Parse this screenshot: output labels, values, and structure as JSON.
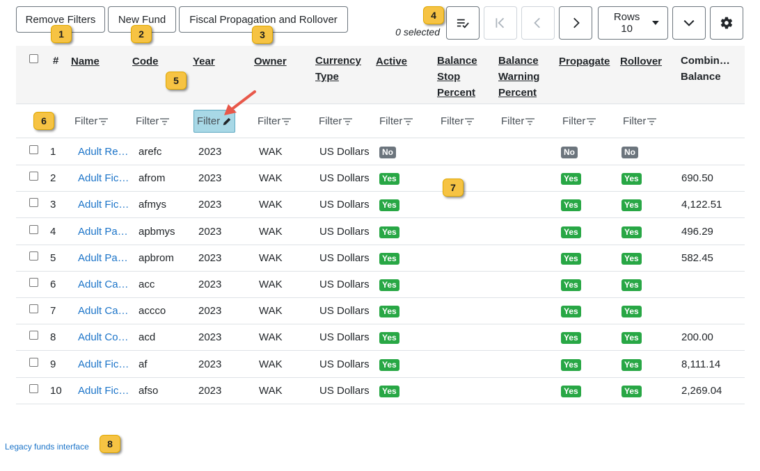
{
  "toolbar": {
    "remove_filters": "Remove Filters",
    "new_fund": "New Fund",
    "fiscal": "Fiscal Propagation and Rollover",
    "selected": "0 selected",
    "rows_label": "Rows 10"
  },
  "markers": [
    "1",
    "2",
    "3",
    "4",
    "5",
    "6",
    "7",
    "8"
  ],
  "columns": {
    "hash": "#",
    "name": "Name",
    "code": "Code",
    "year": "Year",
    "owner": "Owner",
    "currency_l1": "Currency",
    "currency_l2": "Type",
    "active": "Active",
    "stop_l1": "Balance",
    "stop_l2": "Stop",
    "stop_l3": "Percent",
    "warn_l1": "Balance",
    "warn_l2": "Warning",
    "warn_l3": "Percent",
    "propagate": "Propagate",
    "rollover": "Rollover",
    "combined_l1": "Combin…",
    "combined_l2": "Balance"
  },
  "filter_label": "Filter",
  "rows": [
    {
      "num": "1",
      "name": "Adult Re…",
      "code": "arefc",
      "year": "2023",
      "owner": "WAK",
      "currency": "US Dollars",
      "active": "No",
      "propagate": "No",
      "rollover": "No",
      "balance": ""
    },
    {
      "num": "2",
      "name": "Adult Fic…",
      "code": "afrom",
      "year": "2023",
      "owner": "WAK",
      "currency": "US Dollars",
      "active": "Yes",
      "propagate": "Yes",
      "rollover": "Yes",
      "balance": "690.50"
    },
    {
      "num": "3",
      "name": "Adult Fic…",
      "code": "afmys",
      "year": "2023",
      "owner": "WAK",
      "currency": "US Dollars",
      "active": "Yes",
      "propagate": "Yes",
      "rollover": "Yes",
      "balance": "4,122.51"
    },
    {
      "num": "4",
      "name": "Adult Pa…",
      "code": "apbmys",
      "year": "2023",
      "owner": "WAK",
      "currency": "US Dollars",
      "active": "Yes",
      "propagate": "Yes",
      "rollover": "Yes",
      "balance": "496.29"
    },
    {
      "num": "5",
      "name": "Adult Pa…",
      "code": "apbrom",
      "year": "2023",
      "owner": "WAK",
      "currency": "US Dollars",
      "active": "Yes",
      "propagate": "Yes",
      "rollover": "Yes",
      "balance": "582.45"
    },
    {
      "num": "6",
      "name": "Adult Ca…",
      "code": "acc",
      "year": "2023",
      "owner": "WAK",
      "currency": "US Dollars",
      "active": "Yes",
      "propagate": "Yes",
      "rollover": "Yes",
      "balance": ""
    },
    {
      "num": "7",
      "name": "Adult Ca…",
      "code": "accco",
      "year": "2023",
      "owner": "WAK",
      "currency": "US Dollars",
      "active": "Yes",
      "propagate": "Yes",
      "rollover": "Yes",
      "balance": ""
    },
    {
      "num": "8",
      "name": "Adult Co…",
      "code": "acd",
      "year": "2023",
      "owner": "WAK",
      "currency": "US Dollars",
      "active": "Yes",
      "propagate": "Yes",
      "rollover": "Yes",
      "balance": "200.00"
    },
    {
      "num": "9",
      "name": "Adult Fic…",
      "code": "af",
      "year": "2023",
      "owner": "WAK",
      "currency": "US Dollars",
      "active": "Yes",
      "propagate": "Yes",
      "rollover": "Yes",
      "balance": "8,111.14"
    },
    {
      "num": "10",
      "name": "Adult Fic…",
      "code": "afso",
      "year": "2023",
      "owner": "WAK",
      "currency": "US Dollars",
      "active": "Yes",
      "propagate": "Yes",
      "rollover": "Yes",
      "balance": "2,269.04"
    }
  ],
  "footer": {
    "legacy_link": "Legacy funds interface"
  },
  "colors": {
    "yes": "#28a745",
    "no": "#6c757d",
    "link": "#1a73c8",
    "marker": "#f6c343",
    "active_filter": "#a8d8e6",
    "arrow": "#e8584a"
  }
}
